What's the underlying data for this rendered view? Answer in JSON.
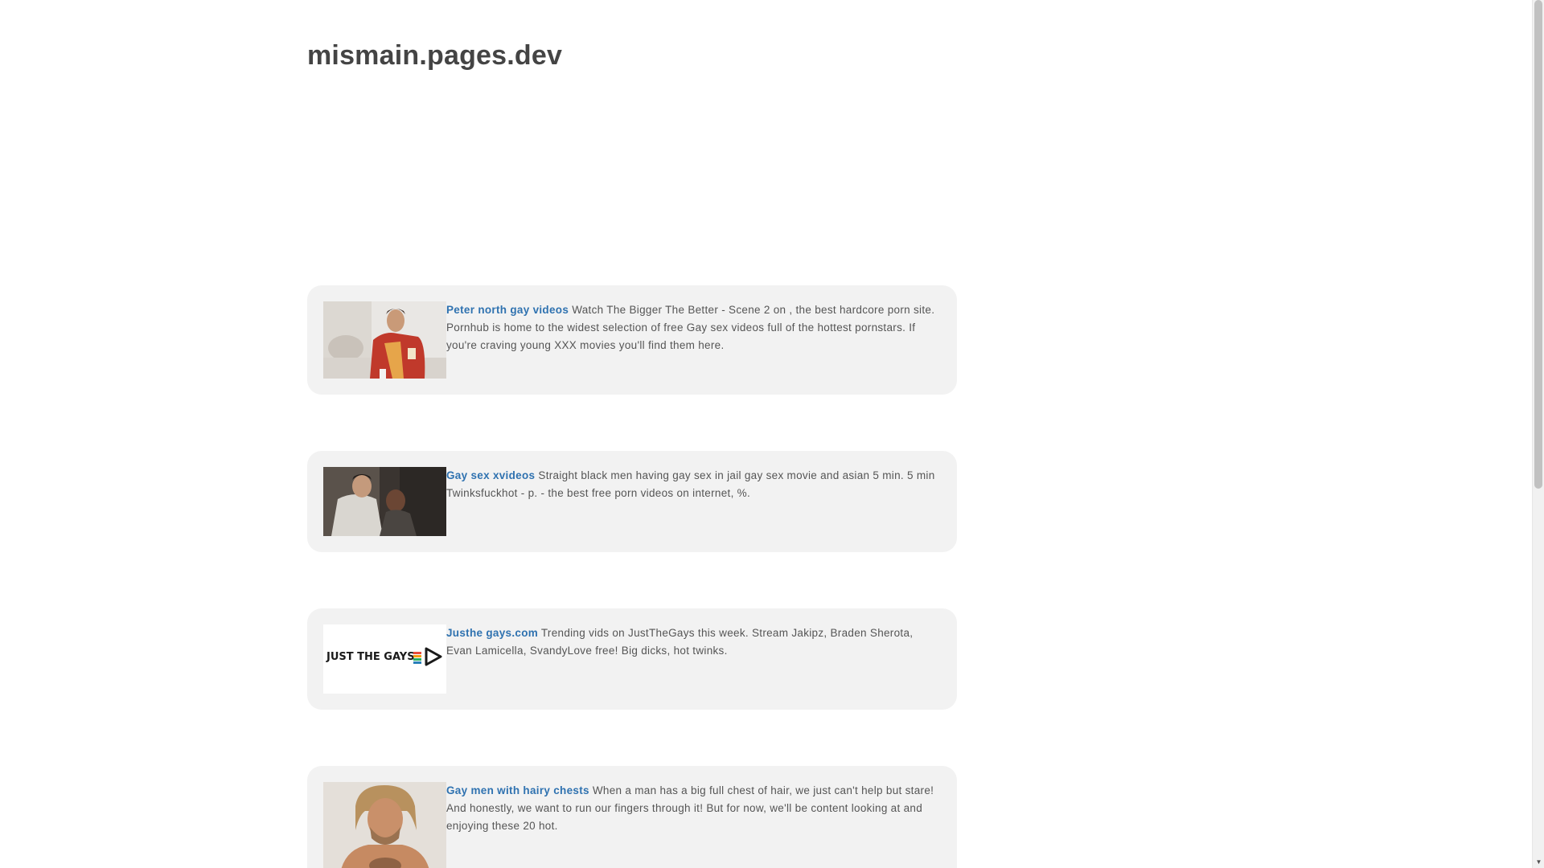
{
  "site": {
    "title": "mismain.pages.dev"
  },
  "cards": [
    {
      "link_text": "Peter north gay videos",
      "description": "Watch The Bigger The Better - Scene 2 on , the best hardcore porn site. Pornhub is home to the widest selection of free Gay sex videos full of the hottest pornstars. If you're craving young XXX movies you'll find them here.",
      "thumb_icon": "photo-thumbnail-icon"
    },
    {
      "link_text": "Gay sex xvideos",
      "description": "Straight black men having gay sex in jail gay sex movie and asian 5 min. 5 min Twinksfuckhot - p. - the best free porn videos on internet, %.",
      "thumb_icon": "photo-thumbnail-icon"
    },
    {
      "link_text": "Justhe gays.com",
      "description": "Trending vids on JustTheGays this week. Stream Jakipz, Braden Sherota, Evan Lamicella, SvandyLove free! Big dicks, hot twinks.",
      "thumb_logo_text": "JUST THE GAYS",
      "thumb_icon": "logo-thumbnail-icon"
    },
    {
      "link_text": "Gay men with hairy chests",
      "description": "When a man has a big full chest of hair, we just can't help but stare! And honestly, we want to run our fingers through it! But for now, we'll be content looking at and enjoying these 20 hot.",
      "thumb_icon": "photo-thumbnail-icon"
    }
  ],
  "colors": {
    "link": "#2f72b0",
    "card_bg": "#f2f2f2",
    "title": "#444444"
  }
}
